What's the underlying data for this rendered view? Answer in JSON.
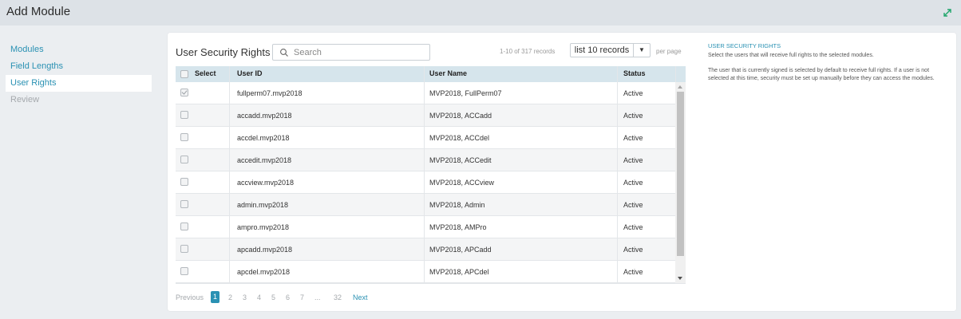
{
  "header": {
    "title": "Add Module",
    "expand_icon": "expand-arrows-icon",
    "accent": "#2a91b3"
  },
  "nav": {
    "items": [
      {
        "label": "Modules",
        "state": "link"
      },
      {
        "label": "Field Lengths",
        "state": "link"
      },
      {
        "label": "User Rights",
        "state": "active"
      },
      {
        "label": "Review",
        "state": "disabled"
      }
    ]
  },
  "grid": {
    "title": "User Security Rights |",
    "search_placeholder": "Search",
    "search_value": "",
    "range": "1-10 of 317 records",
    "page_size": "list 10 records",
    "per_page": "per page",
    "columns": {
      "select": "Select",
      "user_id": "User ID",
      "user_name": "User Name",
      "status": "Status"
    },
    "rows": [
      {
        "user_id": "fullperm07.mvp2018",
        "user_name": "MVP2018, FullPerm07",
        "status": "Active",
        "checked": true
      },
      {
        "user_id": "accadd.mvp2018",
        "user_name": "MVP2018, ACCadd",
        "status": "Active",
        "checked": false
      },
      {
        "user_id": "accdel.mvp2018",
        "user_name": "MVP2018, ACCdel",
        "status": "Active",
        "checked": false
      },
      {
        "user_id": "accedit.mvp2018",
        "user_name": "MVP2018, ACCedit",
        "status": "Active",
        "checked": false
      },
      {
        "user_id": "accview.mvp2018",
        "user_name": "MVP2018, ACCview",
        "status": "Active",
        "checked": false
      },
      {
        "user_id": "admin.mvp2018",
        "user_name": "MVP2018, Admin",
        "status": "Active",
        "checked": false
      },
      {
        "user_id": "ampro.mvp2018",
        "user_name": "MVP2018, AMPro",
        "status": "Active",
        "checked": false
      },
      {
        "user_id": "apcadd.mvp2018",
        "user_name": "MVP2018, APCadd",
        "status": "Active",
        "checked": false
      },
      {
        "user_id": "apcdel.mvp2018",
        "user_name": "MVP2018, APCdel",
        "status": "Active",
        "checked": false
      }
    ]
  },
  "pagination": {
    "previous": "Previous",
    "current": "1",
    "pages": [
      "2",
      "3",
      "4",
      "5",
      "6",
      "7",
      "...",
      "32"
    ],
    "next": "Next"
  },
  "help": {
    "title": "USER SECURITY RIGHTS",
    "text1": "Select the users that will receive full rights to the selected modules.",
    "text2": "The user that is currently signed is selected by default to receive full rights. If a user is not selected at this time, security must be set up manually before they can access the modules."
  }
}
